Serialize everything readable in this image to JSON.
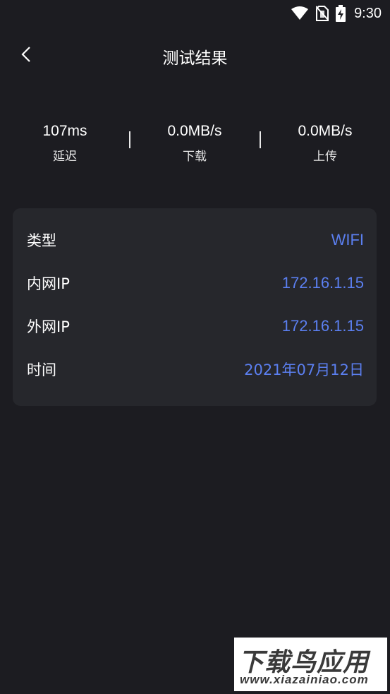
{
  "status_bar": {
    "time": "9:30",
    "icons": [
      "wifi-icon",
      "no-sim-icon",
      "battery-charging-icon"
    ]
  },
  "header": {
    "back_icon": "chevron-left-icon",
    "title": "测试结果"
  },
  "stats": [
    {
      "value": "107ms",
      "label": "延迟"
    },
    {
      "value": "0.0MB/s",
      "label": "下载"
    },
    {
      "value": "0.0MB/s",
      "label": "上传"
    }
  ],
  "info": {
    "rows": [
      {
        "key": "类型",
        "value": "WIFI"
      },
      {
        "key": "内网IP",
        "value": "172.16.1.15"
      },
      {
        "key": "外网IP",
        "value": "172.16.1.15"
      },
      {
        "key": "时间",
        "value": "2021年07月12日"
      }
    ]
  },
  "watermark": {
    "main": "下载鸟应用",
    "sub": "www.xiazainiao.com"
  },
  "colors": {
    "background": "#1c1c21",
    "card": "#26272c",
    "accent": "#5b7ff0",
    "text": "#ffffff"
  }
}
